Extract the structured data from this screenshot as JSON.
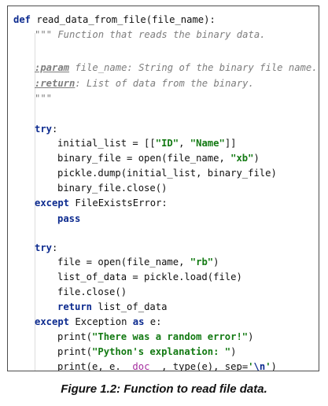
{
  "code": {
    "lines": [
      {
        "indent": 0,
        "tokens": [
          {
            "t": "def ",
            "c": "kw"
          },
          {
            "t": "read_data_from_file(file_name):",
            "c": ""
          }
        ]
      },
      {
        "indent": 1,
        "tokens": [
          {
            "t": "\"\"\" Function that reads the binary data.",
            "c": "doc"
          }
        ]
      },
      {
        "indent": 1,
        "tokens": []
      },
      {
        "indent": 1,
        "tokens": [
          {
            "t": ":param",
            "c": "doctag"
          },
          {
            "t": " file_name: String of the binary file name.",
            "c": "doc"
          }
        ]
      },
      {
        "indent": 1,
        "tokens": [
          {
            "t": ":return",
            "c": "doctag"
          },
          {
            "t": ": List of data from the binary.",
            "c": "doc"
          }
        ]
      },
      {
        "indent": 1,
        "tokens": [
          {
            "t": "\"\"\"",
            "c": "doc"
          }
        ]
      },
      {
        "indent": 1,
        "tokens": []
      },
      {
        "indent": 1,
        "tokens": [
          {
            "t": "try",
            "c": "kw"
          },
          {
            "t": ":",
            "c": ""
          }
        ]
      },
      {
        "indent": 2,
        "tokens": [
          {
            "t": "initial_list = [[",
            "c": ""
          },
          {
            "t": "\"ID\"",
            "c": "str"
          },
          {
            "t": ", ",
            "c": ""
          },
          {
            "t": "\"Name\"",
            "c": "str"
          },
          {
            "t": "]]",
            "c": ""
          }
        ]
      },
      {
        "indent": 2,
        "tokens": [
          {
            "t": "binary_file = open(file_name, ",
            "c": ""
          },
          {
            "t": "\"xb\"",
            "c": "str"
          },
          {
            "t": ")",
            "c": ""
          }
        ]
      },
      {
        "indent": 2,
        "tokens": [
          {
            "t": "pickle.dump(initial_list, binary_file)",
            "c": ""
          }
        ]
      },
      {
        "indent": 2,
        "tokens": [
          {
            "t": "binary_file.close()",
            "c": ""
          }
        ]
      },
      {
        "indent": 1,
        "tokens": [
          {
            "t": "except",
            "c": "kw"
          },
          {
            "t": " FileExistsError:",
            "c": ""
          }
        ]
      },
      {
        "indent": 2,
        "tokens": [
          {
            "t": "pass",
            "c": "kw"
          }
        ]
      },
      {
        "indent": 1,
        "tokens": []
      },
      {
        "indent": 1,
        "tokens": [
          {
            "t": "try",
            "c": "kw"
          },
          {
            "t": ":",
            "c": ""
          }
        ]
      },
      {
        "indent": 2,
        "tokens": [
          {
            "t": "file = open(file_name, ",
            "c": ""
          },
          {
            "t": "\"rb\"",
            "c": "str"
          },
          {
            "t": ")",
            "c": ""
          }
        ]
      },
      {
        "indent": 2,
        "tokens": [
          {
            "t": "list_of_data = pickle.load(file)",
            "c": ""
          }
        ]
      },
      {
        "indent": 2,
        "tokens": [
          {
            "t": "file.close()",
            "c": ""
          }
        ]
      },
      {
        "indent": 2,
        "tokens": [
          {
            "t": "return",
            "c": "kw"
          },
          {
            "t": " list_of_data",
            "c": ""
          }
        ]
      },
      {
        "indent": 1,
        "tokens": [
          {
            "t": "except",
            "c": "kw"
          },
          {
            "t": " Exception ",
            "c": ""
          },
          {
            "t": "as",
            "c": "kw"
          },
          {
            "t": " e:",
            "c": ""
          }
        ]
      },
      {
        "indent": 2,
        "tokens": [
          {
            "t": "print(",
            "c": ""
          },
          {
            "t": "\"There was a random error!\"",
            "c": "str"
          },
          {
            "t": ")",
            "c": ""
          }
        ]
      },
      {
        "indent": 2,
        "tokens": [
          {
            "t": "print(",
            "c": ""
          },
          {
            "t": "\"Python's explanation: \"",
            "c": "str"
          },
          {
            "t": ")",
            "c": ""
          }
        ]
      },
      {
        "indent": 2,
        "tokens": [
          {
            "t": "print(e, e.",
            "c": ""
          },
          {
            "t": "__doc__",
            "c": "dunder"
          },
          {
            "t": ", type(e), sep=",
            "c": ""
          },
          {
            "t": "'",
            "c": "str"
          },
          {
            "t": "\\n",
            "c": "esc"
          },
          {
            "t": "'",
            "c": "str"
          },
          {
            "t": ")",
            "c": ""
          }
        ]
      }
    ]
  },
  "caption": "Figure 1.2: Function to read file data."
}
